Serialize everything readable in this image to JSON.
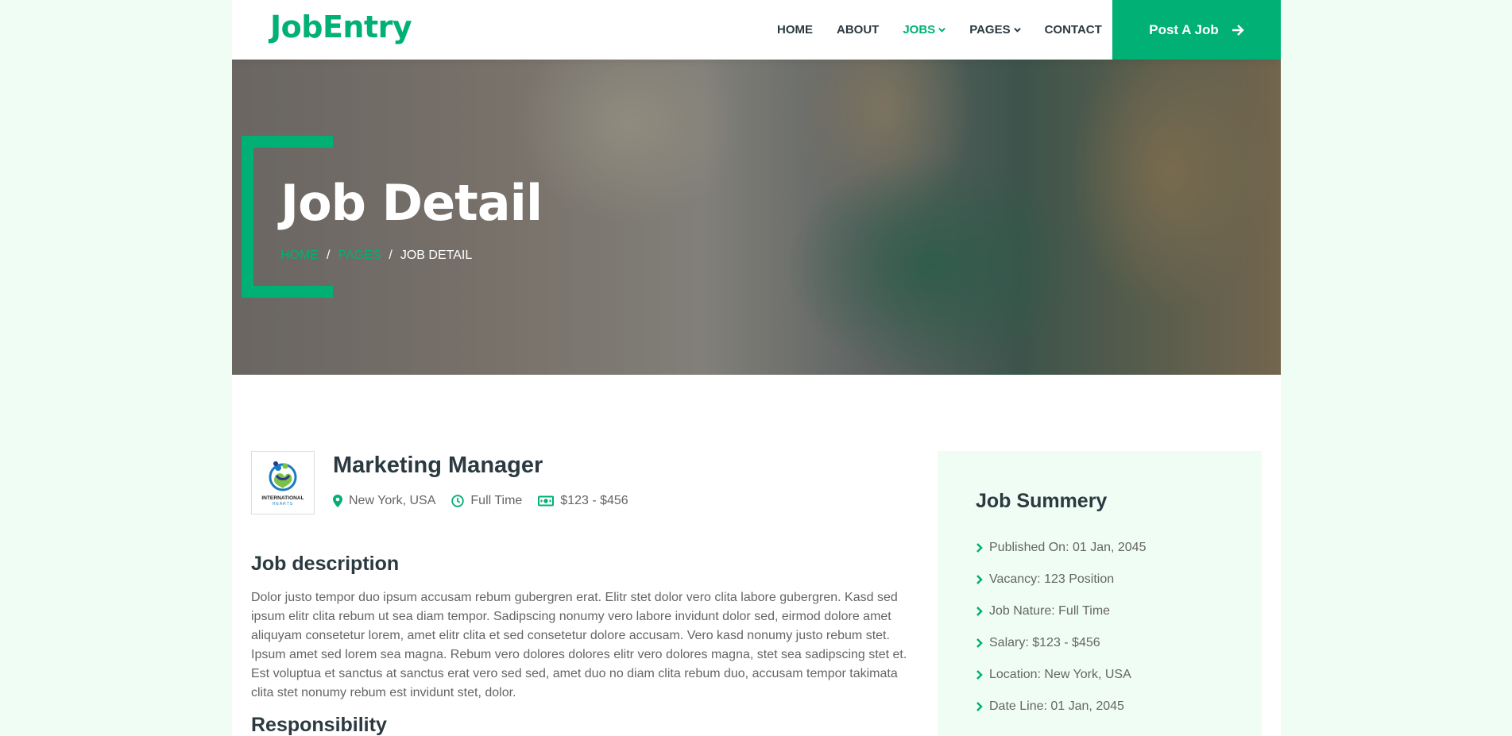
{
  "brand": "JobEntry",
  "nav": {
    "items": [
      {
        "label": "HOME",
        "active": false,
        "dropdown": false
      },
      {
        "label": "ABOUT",
        "active": false,
        "dropdown": false
      },
      {
        "label": "JOBS",
        "active": true,
        "dropdown": true
      },
      {
        "label": "PAGES",
        "active": false,
        "dropdown": true
      },
      {
        "label": "CONTACT",
        "active": false,
        "dropdown": false
      }
    ],
    "post_job_label": "Post A Job"
  },
  "hero": {
    "title": "Job Detail",
    "breadcrumb": [
      "HOME",
      "PAGES",
      "JOB DETAIL"
    ]
  },
  "job": {
    "logo_text": "INTERNATIONAL",
    "logo_subtext": "HEARTS",
    "title": "Marketing Manager",
    "location": "New York, USA",
    "type": "Full Time",
    "salary": "$123 - $456"
  },
  "description": {
    "heading": "Job description",
    "text": "Dolor justo tempor duo ipsum accusam rebum gubergren erat. Elitr stet dolor vero clita labore gubergren. Kasd sed ipsum elitr clita rebum ut sea diam tempor. Sadipscing nonumy vero labore invidunt dolor sed, eirmod dolore amet aliquyam consetetur lorem, amet elitr clita et sed consetetur dolore accusam. Vero kasd nonumy justo rebum stet. Ipsum amet sed lorem sea magna. Rebum vero dolores dolores elitr vero dolores magna, stet sea sadipscing stet et. Est voluptua et sanctus at sanctus erat vero sed sed, amet duo no diam clita rebum duo, accusam tempor takimata clita stet nonumy rebum est invidunt stet, dolor."
  },
  "responsibility": {
    "heading": "Responsibility"
  },
  "summary": {
    "title": "Job Summery",
    "items": [
      "Published On: 01 Jan, 2045",
      "Vacancy: 123 Position",
      "Job Nature: Full Time",
      "Salary: $123 - $456",
      "Location: New York, USA",
      "Date Line: 01 Jan, 2045"
    ]
  },
  "colors": {
    "primary": "#00b074",
    "dark": "#2b3940",
    "light": "#effdf5",
    "text": "#666565"
  }
}
